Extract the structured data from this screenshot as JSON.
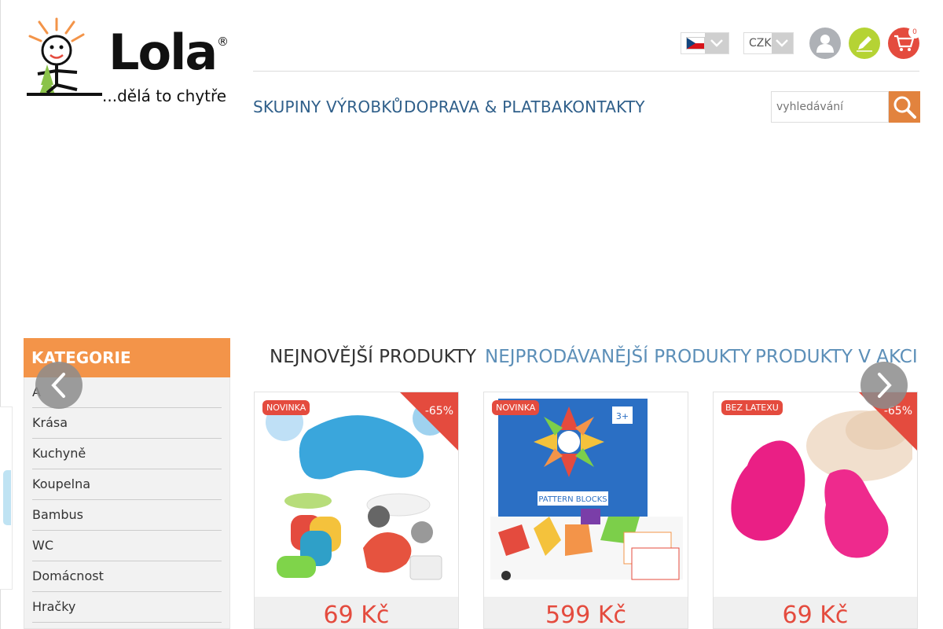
{
  "logo": {
    "word": "Lola",
    "reg": "®",
    "tagline": "...dělá to chytře"
  },
  "header": {
    "language": "cs",
    "currency": "CZK",
    "cart_count": "0"
  },
  "nav": [
    "SKUPINY VÝROBKŮ",
    "DOPRAVA & PLATBA",
    "KONTAKTY"
  ],
  "search": {
    "placeholder": "vyhledávání",
    "value": ""
  },
  "categories": {
    "title": "KATEGORIE",
    "items": [
      "A",
      "Krása",
      "Kuchyně",
      "Koupelna",
      "Bambus",
      "WC",
      "Domácnost",
      "Hračky"
    ]
  },
  "tabs": [
    "NEJNOVĚJŠÍ PRODUKTY",
    "NEJPRODÁVANĚJŠÍ PRODUKTY",
    "PRODUKTY V AKCI"
  ],
  "products": [
    {
      "badge": "NOVINKA",
      "discount": "-65%",
      "price": "69 Kč"
    },
    {
      "badge": "NOVINKA",
      "discount": "",
      "price": "599 Kč",
      "box_text": "PATTERN BLOCKS",
      "age": "3+"
    },
    {
      "badge": "BEZ LATEXU",
      "discount": "-65%",
      "price": "69 Kč"
    }
  ],
  "colors": {
    "accent": "#f39449",
    "sale": "#e44b3e",
    "nav": "#2f5f8a",
    "green": "#b5d334"
  }
}
